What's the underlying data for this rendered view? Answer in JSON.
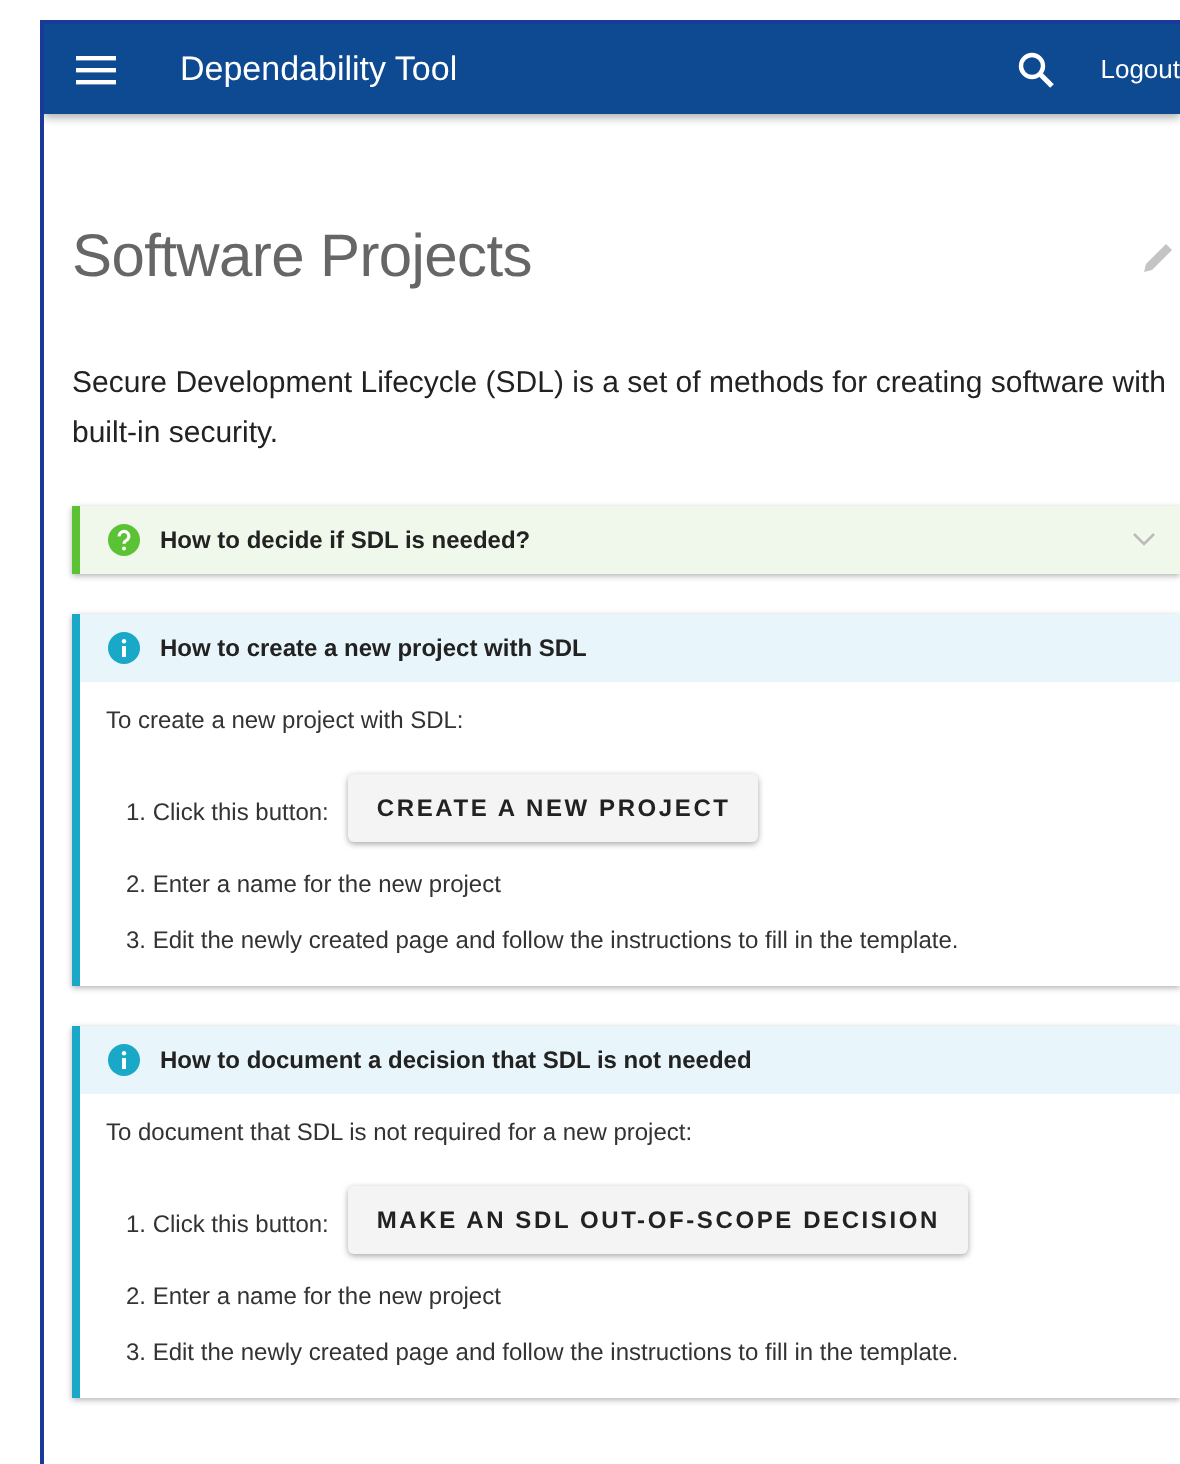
{
  "app_bar": {
    "title": "Dependability Tool",
    "logout": "Logout"
  },
  "page": {
    "title": "Software Projects",
    "intro": "Secure Development Lifecycle (SDL) is a set of methods for creating software with built-in security."
  },
  "panels": [
    {
      "kind": "question",
      "title": "How to decide if SDL is needed?",
      "expanded": false
    },
    {
      "kind": "info",
      "title": "How to create a new project with SDL",
      "lead": "To create a new project with SDL:",
      "steps": [
        {
          "text": "1. Click this button:",
          "button": "CREATE A NEW PROJECT"
        },
        {
          "text": "2. Enter a name for the new project"
        },
        {
          "text": "3. Edit the newly created page and follow the instructions to fill in the template."
        }
      ]
    },
    {
      "kind": "info",
      "title": "How to document a decision that SDL is not needed",
      "lead": "To document that SDL is not required for a new project:",
      "steps": [
        {
          "text": "1. Click this button:",
          "button": "MAKE AN SDL OUT-OF-SCOPE DECISION"
        },
        {
          "text": "2. Enter a name for the new project"
        },
        {
          "text": "3. Edit the newly created page and follow the instructions to fill in the template."
        }
      ]
    }
  ]
}
